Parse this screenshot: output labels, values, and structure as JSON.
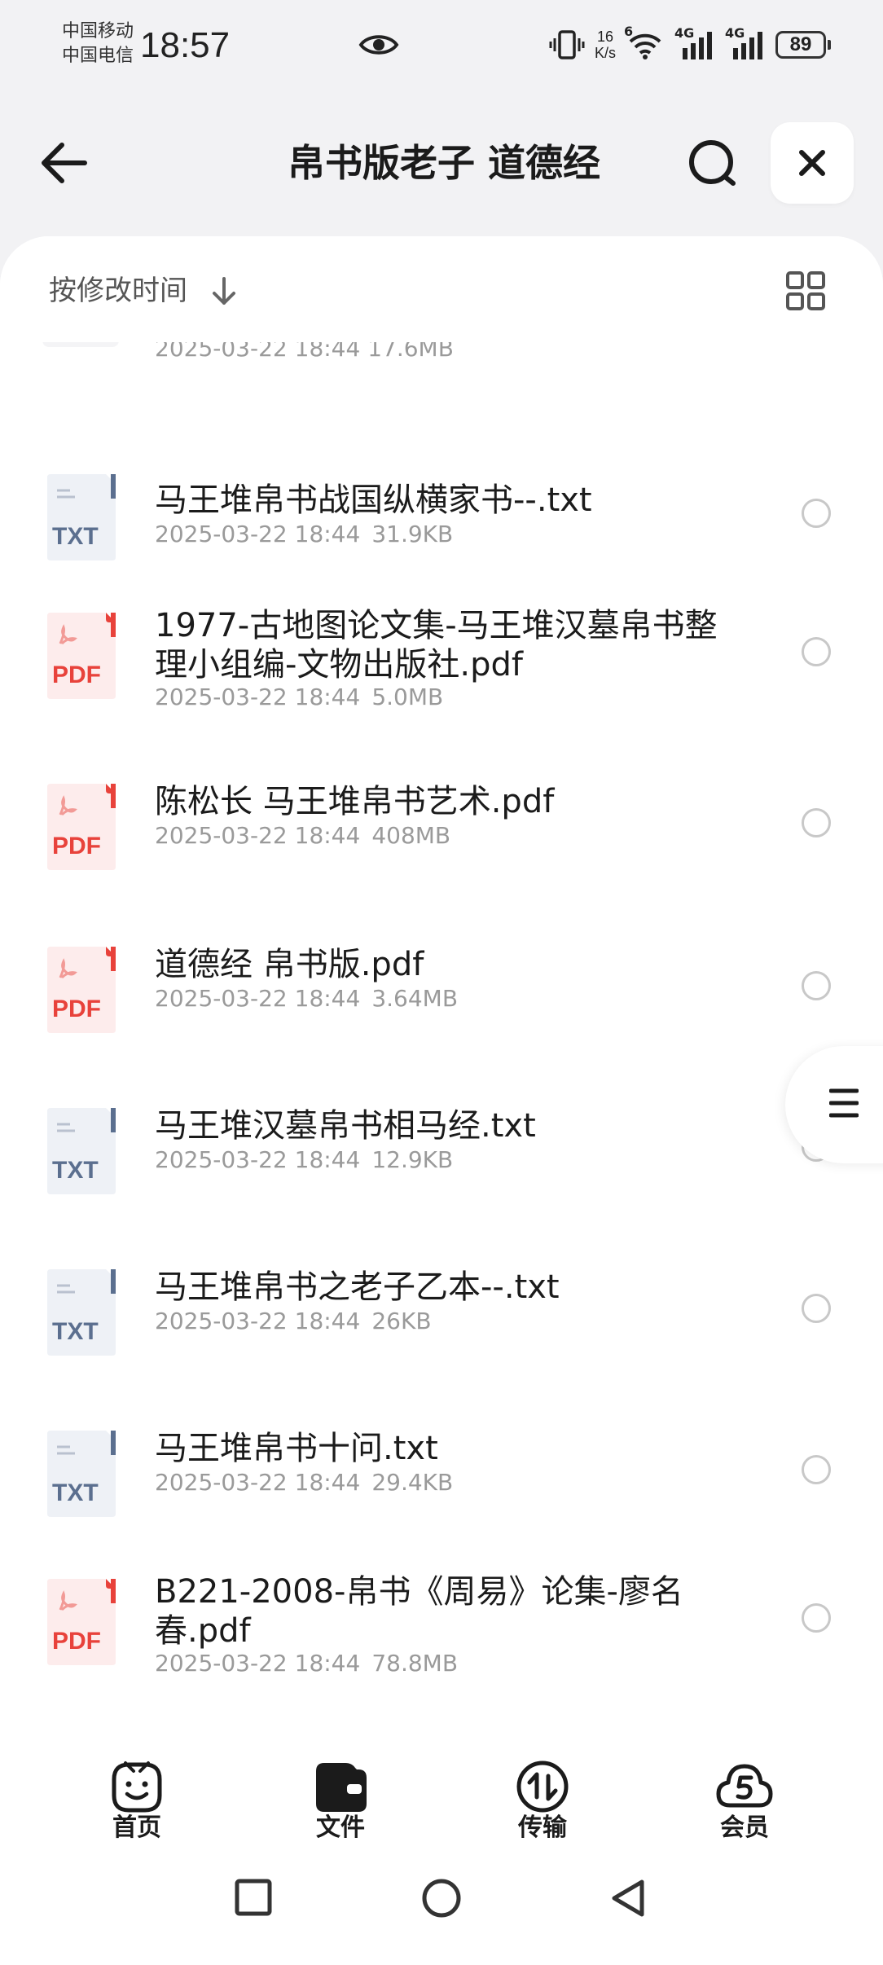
{
  "status_bar": {
    "carrier_1": "中国移动",
    "carrier_2": "中国电信",
    "time": "18:57",
    "net_speed_value": "16",
    "net_speed_unit": "K/s",
    "wifi_badge": "6",
    "signal_1_label": "4G",
    "signal_2_label": "4G",
    "battery": "89"
  },
  "header": {
    "title": "帛书版老子 道德经"
  },
  "sort": {
    "label": "按修改时间"
  },
  "partial_item": {
    "meta": "2025-03-22 18:44  17.6MB"
  },
  "files": [
    {
      "name": "马王堆帛书战国纵横家书--.txt",
      "type": "TXT",
      "date": "2025-03-22 18:44",
      "size": "31.9KB"
    },
    {
      "name": "1977-古地图论文集-马王堆汉墓帛书整理小组编-文物出版社.pdf",
      "type": "PDF",
      "date": "2025-03-22 18:44",
      "size": "5.0MB"
    },
    {
      "name": "陈松长 马王堆帛书艺术.pdf",
      "type": "PDF",
      "date": "2025-03-22 18:44",
      "size": "408MB"
    },
    {
      "name": "道德经 帛书版.pdf",
      "type": "PDF",
      "date": "2025-03-22 18:44",
      "size": "3.64MB"
    },
    {
      "name": "马王堆汉墓帛书相马经.txt",
      "type": "TXT",
      "date": "2025-03-22 18:44",
      "size": "12.9KB"
    },
    {
      "name": "马王堆帛书之老子乙本--.txt",
      "type": "TXT",
      "date": "2025-03-22 18:44",
      "size": "26KB"
    },
    {
      "name": "马王堆帛书十问.txt",
      "type": "TXT",
      "date": "2025-03-22 18:44",
      "size": "29.4KB"
    },
    {
      "name": "B221-2008-帛书《周易》论集-廖名春.pdf",
      "type": "PDF",
      "date": "2025-03-22 18:44",
      "size": "78.8MB"
    }
  ],
  "tabs": [
    {
      "label": "首页",
      "icon": "home-face-icon"
    },
    {
      "label": "文件",
      "icon": "folder-icon"
    },
    {
      "label": "传输",
      "icon": "transfer-icon"
    },
    {
      "label": "会员",
      "icon": "vip-cloud-icon"
    }
  ],
  "colors": {
    "pdf_red": "#e8423b",
    "txt_blue": "#5b6f8f",
    "meta_gray": "#9a9a9a",
    "background": "#f2f2f4"
  }
}
